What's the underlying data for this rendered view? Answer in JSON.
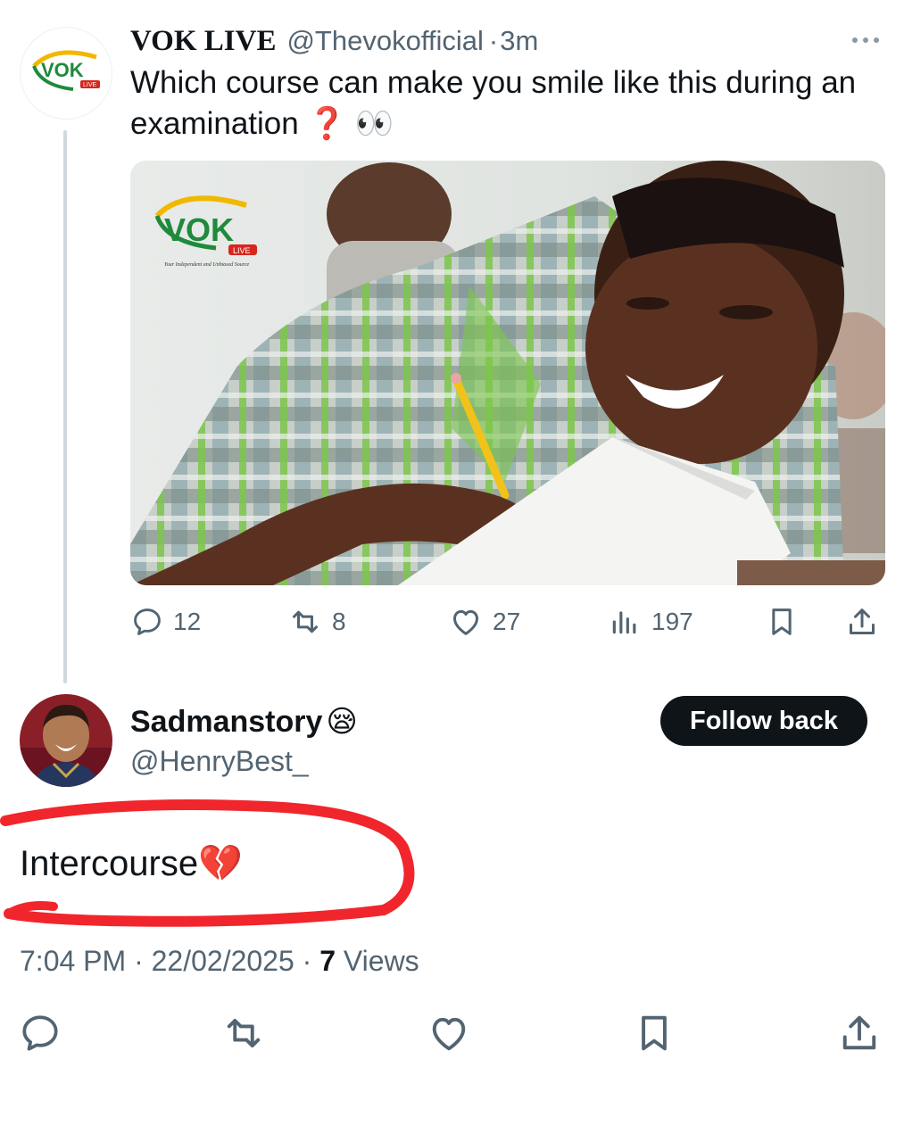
{
  "original_tweet": {
    "display_name": "VOK LIVE",
    "handle": "@Thevokofficial",
    "separator": "·",
    "time_ago": "3m",
    "text": "Which course can make you smile like this during an examination",
    "emoji": "❓ 👀",
    "avatar_logo": {
      "text": "VOK",
      "badge": "LIVE"
    },
    "media_logo": {
      "text": "VOK",
      "badge": "LIVE",
      "tagline": "Your Independent and Unbiased Source"
    },
    "actions": {
      "replies": "12",
      "reposts": "8",
      "likes": "27",
      "views": "197"
    }
  },
  "reply": {
    "display_name": "Sadmanstory",
    "name_emoji": "😪",
    "handle": "@HenryBest_",
    "follow_label": "Follow back",
    "text": "Intercourse",
    "text_emoji": "💔",
    "time": "7:04 PM",
    "date": "22/02/2025",
    "separator": "·",
    "views_count": "7",
    "views_label": "Views"
  },
  "icons": {
    "reply": "reply-icon",
    "repost": "repost-icon",
    "like": "like-icon",
    "views": "views-icon",
    "bookmark": "bookmark-icon",
    "share": "share-icon",
    "more": "more-icon"
  },
  "colors": {
    "text": "#0f1419",
    "secondary": "#536471",
    "annotation_red": "#f0262c",
    "vok_green": "#1f8a3c",
    "vok_yellow": "#f1b800",
    "vok_red": "#d7261e"
  }
}
